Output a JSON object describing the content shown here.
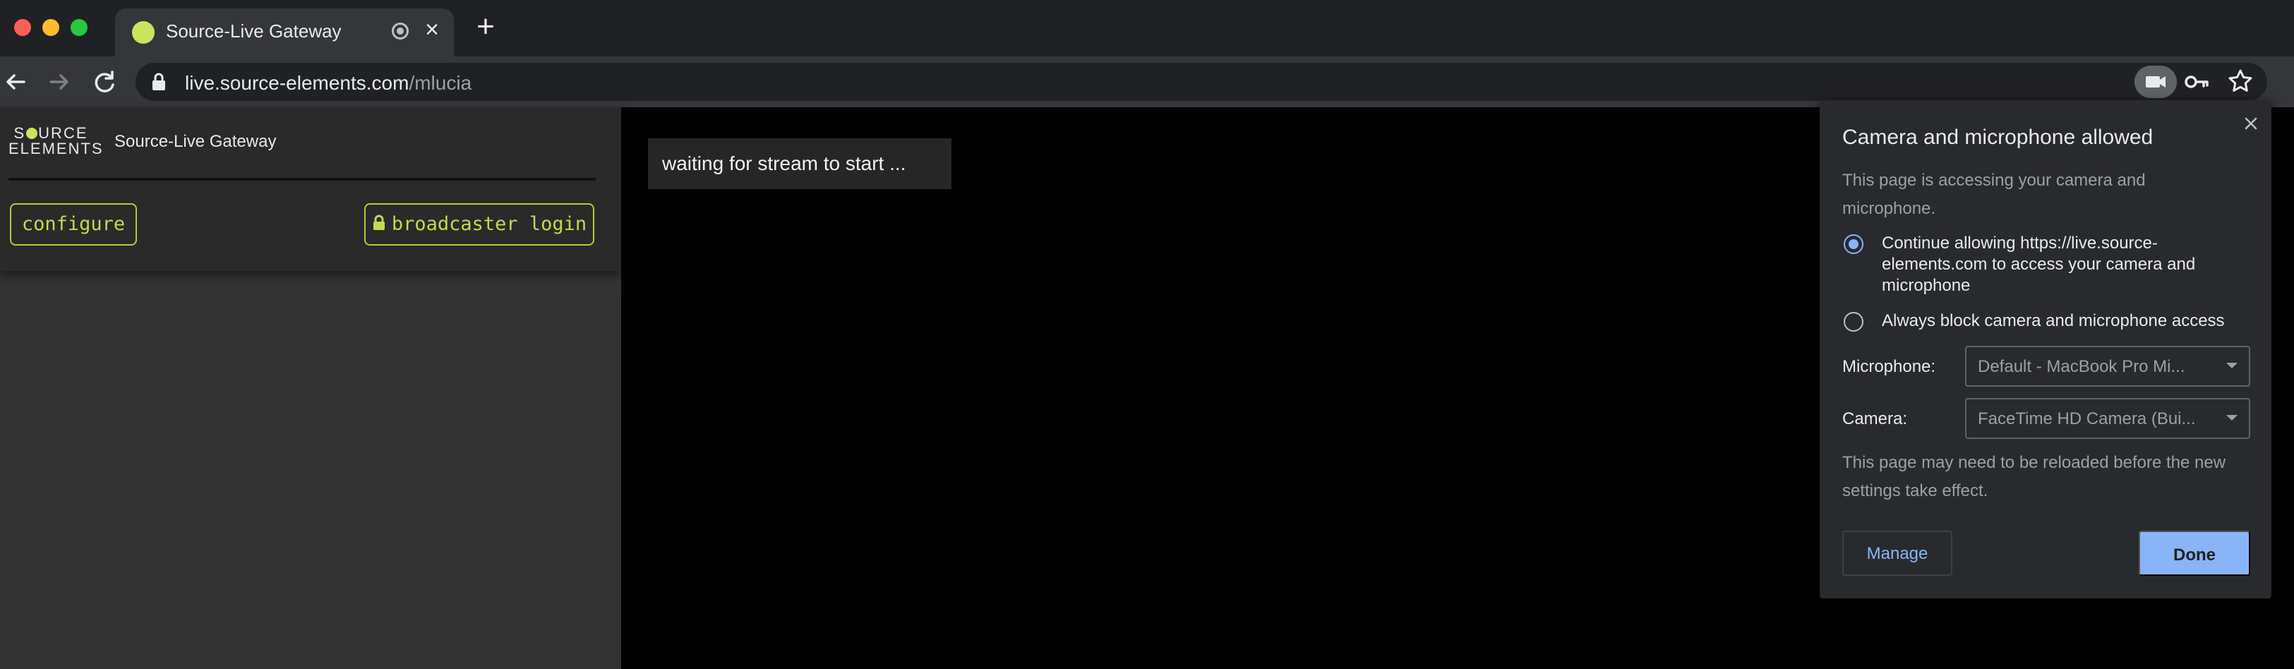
{
  "browser": {
    "tab": {
      "title": "Source-Live Gateway"
    },
    "url": {
      "host": "live.source-elements.com",
      "path": "/mlucia"
    },
    "icons": [
      "back-icon",
      "forward-icon",
      "reload-icon",
      "lock-icon",
      "camera-icon",
      "key-icon",
      "star-icon",
      "close-icon",
      "plus-icon"
    ]
  },
  "sidebar": {
    "logo": {
      "line1_pre": "S",
      "line1_post": "URCE",
      "line2": "ELEMENTS"
    },
    "title": "Source-Live Gateway",
    "configure_label": "configure",
    "login_label": "broadcaster login"
  },
  "main": {
    "status": "waiting for stream to start ..."
  },
  "permission_bubble": {
    "title": "Camera and microphone allowed",
    "description": "This page is accessing your camera and microphone.",
    "options": [
      {
        "label": "Continue allowing https://live.source-elements.com to access your camera and microphone",
        "selected": true
      },
      {
        "label": "Always block camera and microphone access",
        "selected": false
      }
    ],
    "microphone": {
      "label": "Microphone:",
      "value": "Default - MacBook Pro Mi..."
    },
    "camera": {
      "label": "Camera:",
      "value": "FaceTime HD Camera (Bui..."
    },
    "note": "This page may need to be reloaded before the new settings take effect.",
    "manage_label": "Manage",
    "done_label": "Done"
  },
  "colors": {
    "accent_green": "#c3d94e",
    "chrome_blue": "#8ab4f8",
    "panel_bg": "#333333"
  }
}
